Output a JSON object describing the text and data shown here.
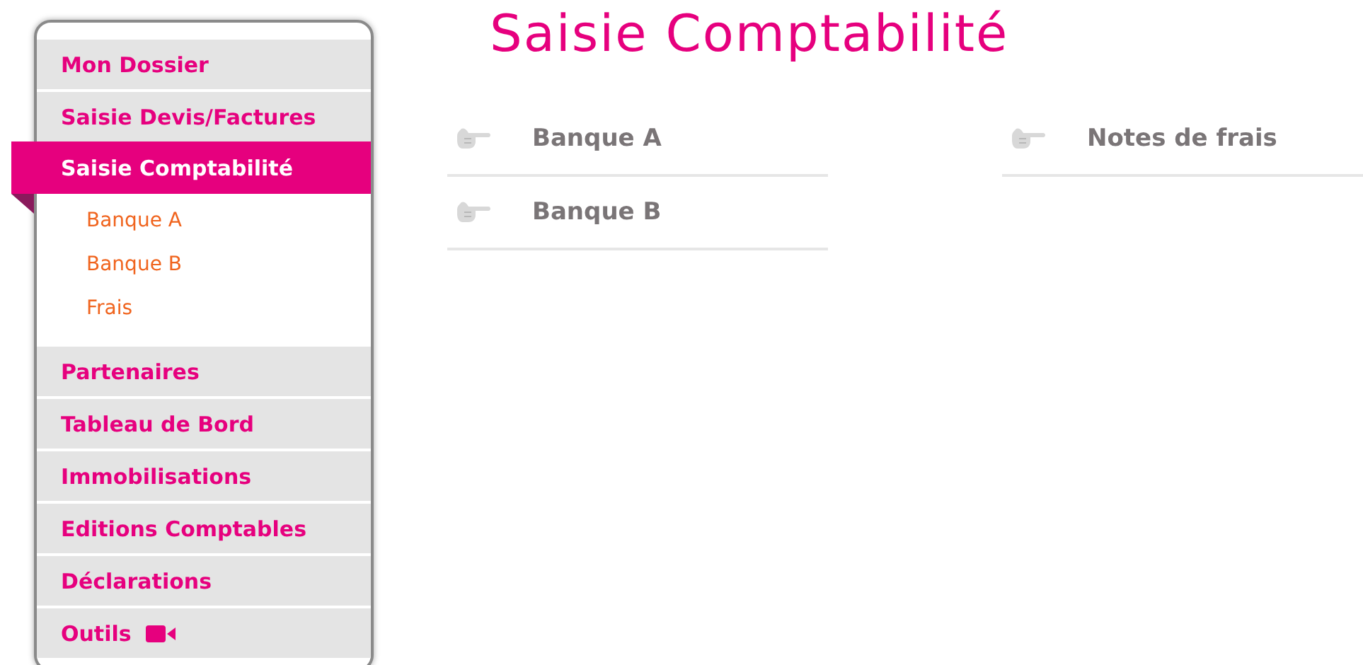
{
  "sidebar": {
    "items": [
      {
        "label": "Mon Dossier",
        "selected": false,
        "kind": "plain"
      },
      {
        "label": "Saisie Devis/Factures",
        "selected": false,
        "kind": "plain"
      },
      {
        "label": "Saisie Comptabilité",
        "selected": true,
        "kind": "plain",
        "children": [
          {
            "label": "Banque A"
          },
          {
            "label": "Banque B"
          },
          {
            "label": "Frais"
          }
        ]
      },
      {
        "label": "Partenaires",
        "selected": false,
        "kind": "plain"
      },
      {
        "label": "Tableau de Bord",
        "selected": false,
        "kind": "plain"
      },
      {
        "label": "Immobilisations",
        "selected": false,
        "kind": "plain"
      },
      {
        "label": "Editions Comptables",
        "selected": false,
        "kind": "plain"
      },
      {
        "label": "Déclarations",
        "selected": false,
        "kind": "plain"
      },
      {
        "label": "Outils",
        "selected": false,
        "kind": "video"
      }
    ]
  },
  "page": {
    "title": "Saisie Comptabilité",
    "columns": [
      [
        {
          "label": "Banque A"
        },
        {
          "label": "Banque B"
        }
      ],
      [
        {
          "label": "Notes de frais"
        }
      ]
    ]
  }
}
